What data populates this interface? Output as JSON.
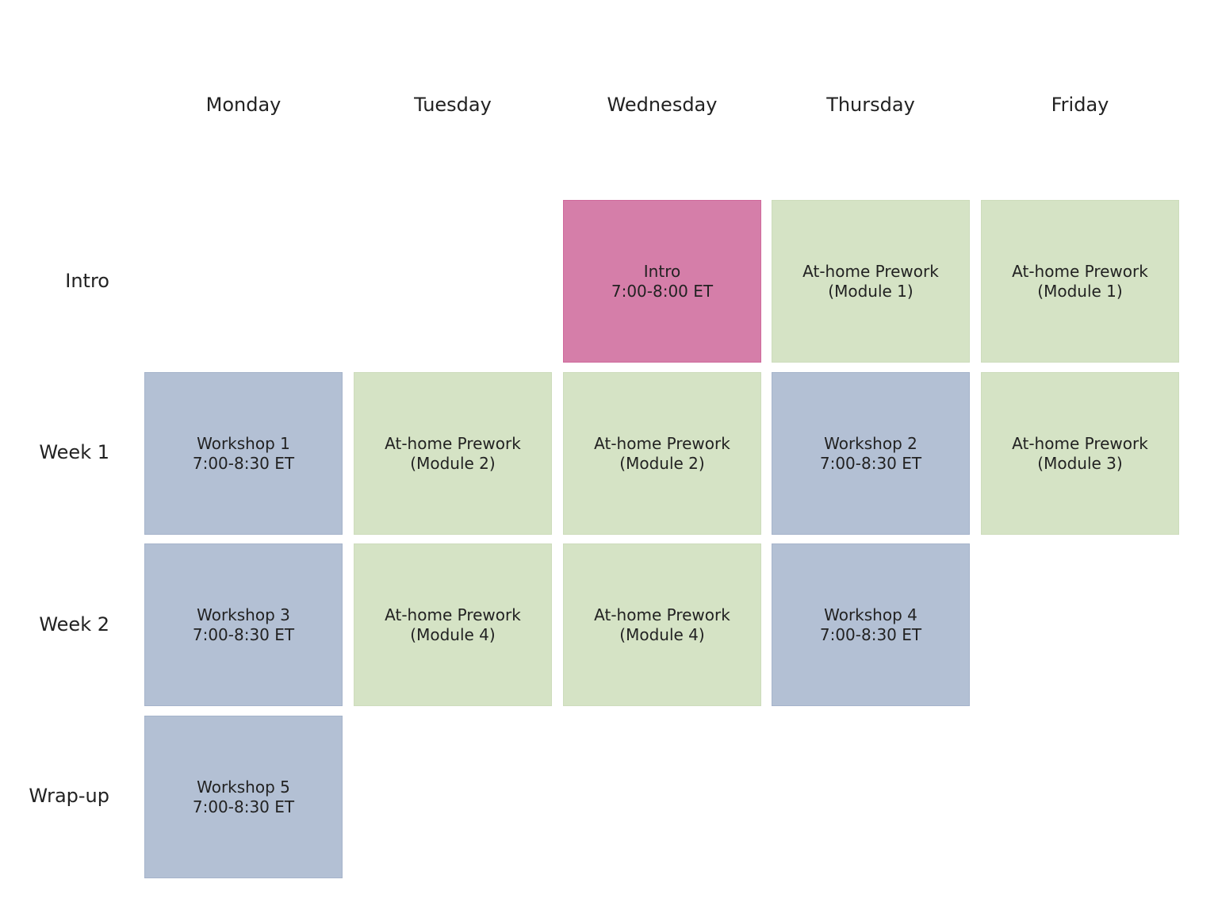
{
  "columns": [
    "Monday",
    "Tuesday",
    "Wednesday",
    "Thursday",
    "Friday"
  ],
  "rows": [
    "Intro",
    "Week 1",
    "Week 2",
    "Wrap-up"
  ],
  "colors": {
    "workshop": "#b3c0d4",
    "prework": "#d5e3c5",
    "intro": "#d57ea9"
  },
  "cells": [
    {
      "row": 0,
      "col": 2,
      "type": "intro",
      "line1": "Intro",
      "line2": "7:00-8:00 ET"
    },
    {
      "row": 0,
      "col": 3,
      "type": "prework",
      "line1": "At-home Prework",
      "line2": "(Module 1)"
    },
    {
      "row": 0,
      "col": 4,
      "type": "prework",
      "line1": "At-home Prework",
      "line2": "(Module 1)"
    },
    {
      "row": 1,
      "col": 0,
      "type": "workshop",
      "line1": "Workshop 1",
      "line2": "7:00-8:30 ET"
    },
    {
      "row": 1,
      "col": 1,
      "type": "prework",
      "line1": "At-home Prework",
      "line2": "(Module 2)"
    },
    {
      "row": 1,
      "col": 2,
      "type": "prework",
      "line1": "At-home Prework",
      "line2": "(Module 2)"
    },
    {
      "row": 1,
      "col": 3,
      "type": "workshop",
      "line1": "Workshop 2",
      "line2": "7:00-8:30 ET"
    },
    {
      "row": 1,
      "col": 4,
      "type": "prework",
      "line1": "At-home Prework",
      "line2": "(Module 3)"
    },
    {
      "row": 2,
      "col": 0,
      "type": "workshop",
      "line1": "Workshop 3",
      "line2": "7:00-8:30 ET"
    },
    {
      "row": 2,
      "col": 1,
      "type": "prework",
      "line1": "At-home Prework",
      "line2": "(Module 4)"
    },
    {
      "row": 2,
      "col": 2,
      "type": "prework",
      "line1": "At-home Prework",
      "line2": "(Module 4)"
    },
    {
      "row": 2,
      "col": 3,
      "type": "workshop",
      "line1": "Workshop 4",
      "line2": "7:00-8:30 ET"
    },
    {
      "row": 3,
      "col": 0,
      "type": "workshop",
      "line1": "Workshop 5",
      "line2": "7:00-8:30 ET"
    }
  ]
}
